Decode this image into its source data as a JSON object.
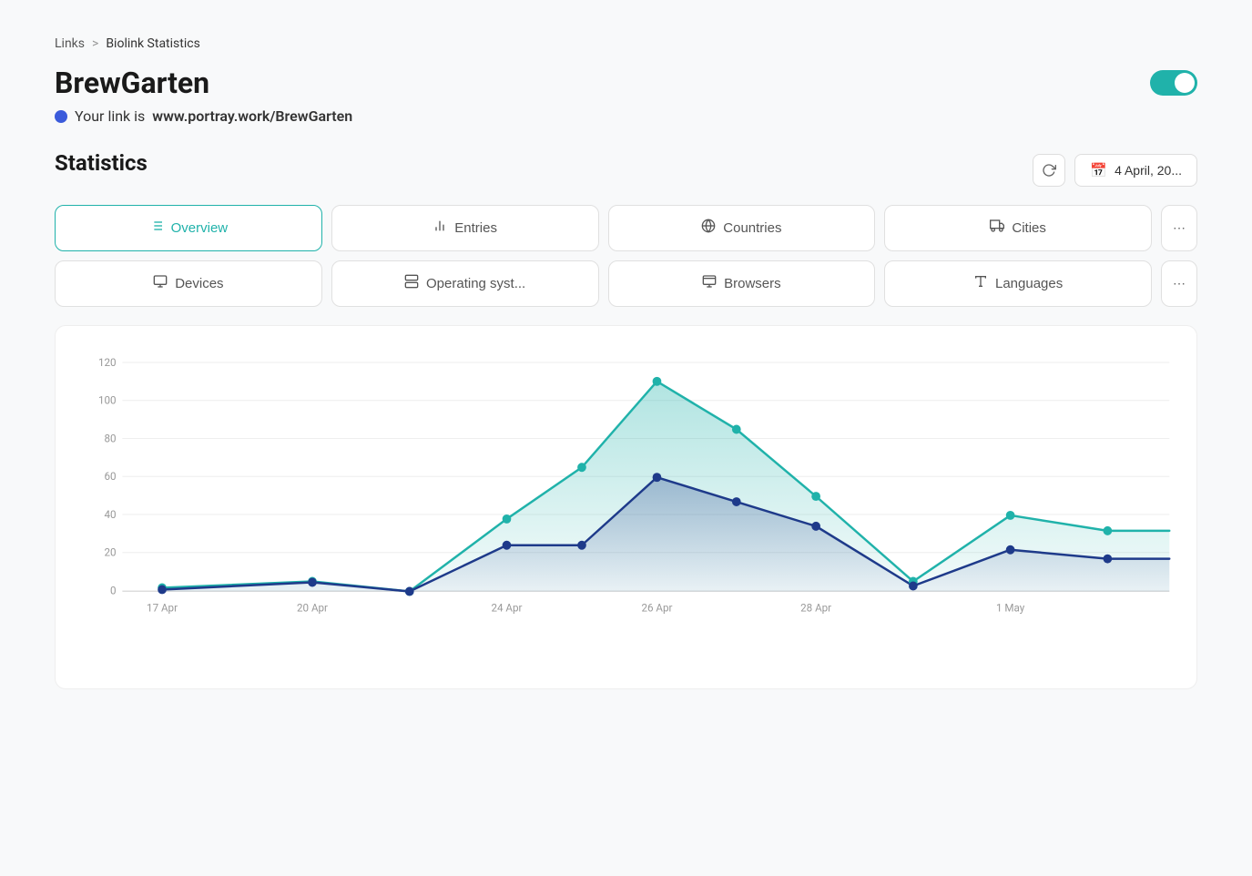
{
  "breadcrumb": {
    "links": [
      "Links"
    ],
    "separator": ">",
    "current": "Biolink Statistics"
  },
  "page": {
    "title": "BrewGarten",
    "link_prefix": "Your link is",
    "link_url": "www.portray.work/BrewGarten",
    "toggle_on": true
  },
  "statistics": {
    "title": "Statistics",
    "date_label": "4 April, 20..."
  },
  "tabs": {
    "row1": [
      {
        "id": "overview",
        "label": "Overview",
        "icon": "≡",
        "active": true
      },
      {
        "id": "entries",
        "label": "Entries",
        "icon": "📊",
        "active": false
      },
      {
        "id": "countries",
        "label": "Countries",
        "icon": "🌐",
        "active": false
      },
      {
        "id": "cities",
        "label": "Cities",
        "icon": "🏙",
        "active": false
      }
    ],
    "row2": [
      {
        "id": "devices",
        "label": "Devices",
        "icon": "💻",
        "active": false
      },
      {
        "id": "operating-systems",
        "label": "Operating syst...",
        "icon": "⚙",
        "active": false
      },
      {
        "id": "browsers",
        "label": "Browsers",
        "icon": "🖥",
        "active": false
      },
      {
        "id": "languages",
        "label": "Languages",
        "icon": "🔤",
        "active": false
      }
    ],
    "overflow": "..."
  },
  "chart": {
    "y_labels": [
      "0",
      "20",
      "40",
      "60",
      "80",
      "100",
      "120"
    ],
    "x_labels": [
      "17 Apr",
      "20 Apr",
      "24 Apr",
      "26 Apr",
      "28 Apr",
      "1 May"
    ],
    "series1_color": "#20b2aa",
    "series2_color": "#1e3a8a",
    "series1_fill": "rgba(32,178,170,0.2)",
    "series2_fill": "rgba(30,58,138,0.15)"
  }
}
